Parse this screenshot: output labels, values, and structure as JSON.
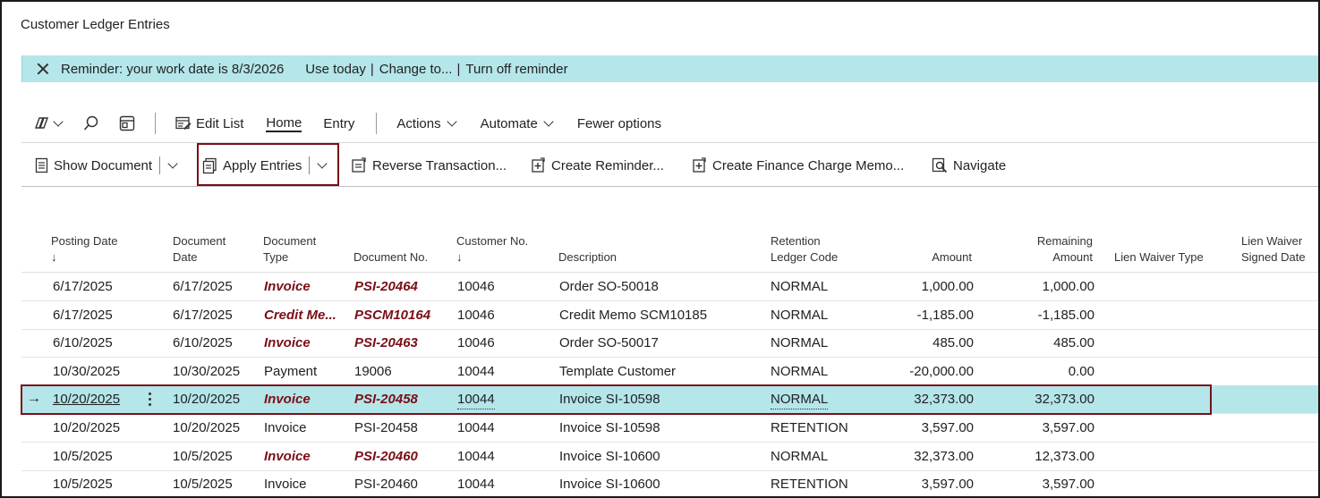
{
  "page": {
    "title": "Customer Ledger Entries"
  },
  "reminder": {
    "text": "Reminder: your work date is 8/3/2026",
    "use_today": "Use today",
    "change_to": "Change to...",
    "turn_off": "Turn off reminder",
    "sep": "|"
  },
  "actionbar": {
    "edit_list": "Edit List",
    "tabs": [
      "Home",
      "Entry"
    ],
    "actions": "Actions",
    "automate": "Automate",
    "fewer_options": "Fewer options"
  },
  "toolbar": {
    "show_document": "Show Document",
    "apply_entries": "Apply Entries",
    "reverse_transaction": "Reverse Transaction...",
    "create_reminder": "Create Reminder...",
    "create_finance_charge_memo": "Create Finance Charge Memo...",
    "navigate": "Navigate"
  },
  "table": {
    "columns": {
      "posting_date": [
        "Posting Date",
        "↓"
      ],
      "document_date": [
        "Document",
        "Date"
      ],
      "document_type": [
        "Document",
        "Type"
      ],
      "document_no": "Document No.",
      "customer_no": [
        "Customer No.",
        "↓"
      ],
      "description": "Description",
      "retention_ledger_code": [
        "Retention",
        "Ledger Code"
      ],
      "amount": "Amount",
      "remaining_amount": [
        "Remaining",
        "Amount"
      ],
      "lien_waiver_type": "Lien Waiver Type",
      "lien_waiver_signed_date": [
        "Lien Waiver",
        "Signed Date"
      ]
    },
    "rows": [
      {
        "posting_date": "6/17/2025",
        "document_date": "6/17/2025",
        "document_type": "Invoice",
        "document_no": "PSI-20464",
        "customer_no": "10046",
        "description": "Order SO-50018",
        "retention_code": "NORMAL",
        "amount": "1,000.00",
        "remaining_amount": "1,000.00",
        "emphasis": true
      },
      {
        "posting_date": "6/17/2025",
        "document_date": "6/17/2025",
        "document_type": "Credit Me...",
        "document_no": "PSCM10164",
        "customer_no": "10046",
        "description": "Credit Memo SCM10185",
        "retention_code": "NORMAL",
        "amount": "-1,185.00",
        "remaining_amount": "-1,185.00",
        "emphasis": true
      },
      {
        "posting_date": "6/10/2025",
        "document_date": "6/10/2025",
        "document_type": "Invoice",
        "document_no": "PSI-20463",
        "customer_no": "10046",
        "description": "Order SO-50017",
        "retention_code": "NORMAL",
        "amount": "485.00",
        "remaining_amount": "485.00",
        "emphasis": true
      },
      {
        "posting_date": "10/30/2025",
        "document_date": "10/30/2025",
        "document_type": "Payment",
        "document_no": "19006",
        "customer_no": "10044",
        "description": "Template Customer",
        "retention_code": "NORMAL",
        "amount": "-20,000.00",
        "remaining_amount": "0.00",
        "emphasis": false
      },
      {
        "posting_date": "10/20/2025",
        "document_date": "10/20/2025",
        "document_type": "Invoice",
        "document_no": "PSI-20458",
        "customer_no": "10044",
        "description": "Invoice SI-10598",
        "retention_code": "NORMAL",
        "amount": "32,373.00",
        "remaining_amount": "32,373.00",
        "emphasis": true,
        "selected": true,
        "row_marker": "→"
      },
      {
        "posting_date": "10/20/2025",
        "document_date": "10/20/2025",
        "document_type": "Invoice",
        "document_no": "PSI-20458",
        "customer_no": "10044",
        "description": "Invoice SI-10598",
        "retention_code": "RETENTION",
        "amount": "3,597.00",
        "remaining_amount": "3,597.00",
        "emphasis": false
      },
      {
        "posting_date": "10/5/2025",
        "document_date": "10/5/2025",
        "document_type": "Invoice",
        "document_no": "PSI-20460",
        "customer_no": "10044",
        "description": "Invoice SI-10600",
        "retention_code": "NORMAL",
        "amount": "32,373.00",
        "remaining_amount": "12,373.00",
        "emphasis": true
      },
      {
        "posting_date": "10/5/2025",
        "document_date": "10/5/2025",
        "document_type": "Invoice",
        "document_no": "PSI-20460",
        "customer_no": "10044",
        "description": "Invoice SI-10600",
        "retention_code": "RETENTION",
        "amount": "3,597.00",
        "remaining_amount": "3,597.00",
        "emphasis": false
      }
    ]
  },
  "colors": {
    "accent_teal": "#b4e6ea",
    "emphasis_red": "#7a0f17",
    "highlight_border": "#7a0f17"
  }
}
